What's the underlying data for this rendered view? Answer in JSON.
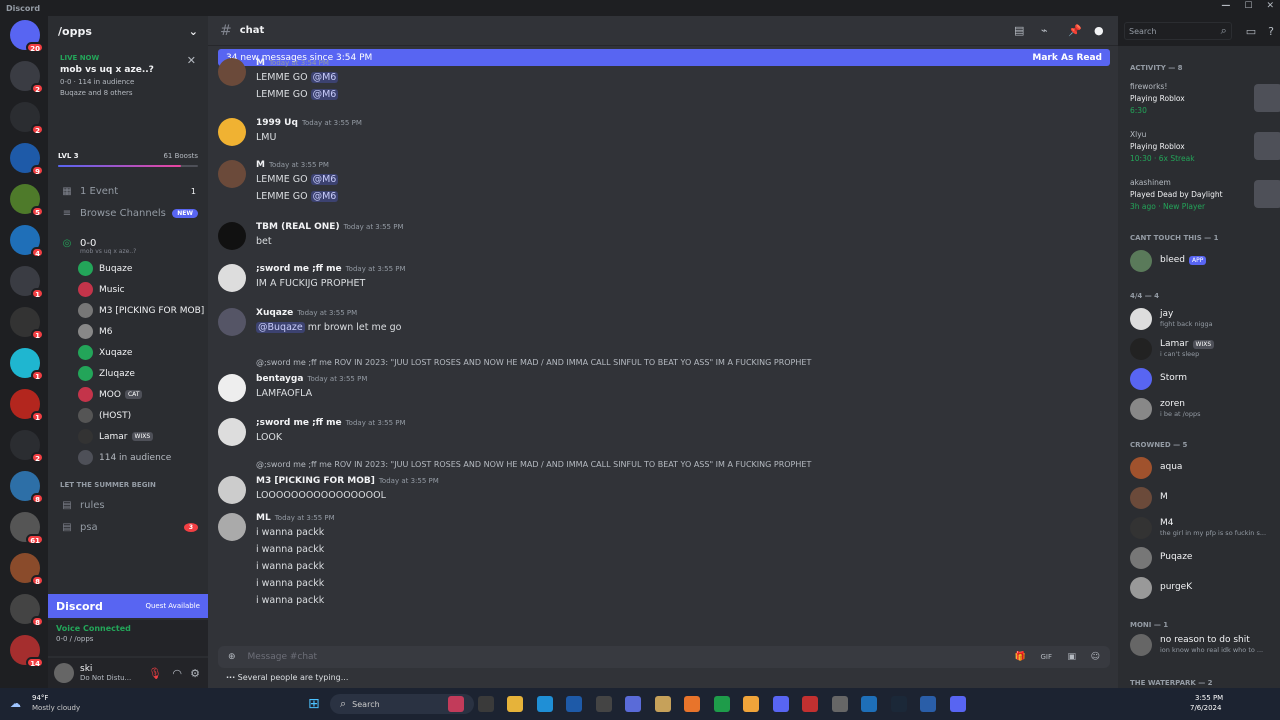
{
  "titlebar": {
    "app": "Discord"
  },
  "guilds": [
    {
      "badge": "20",
      "color": "#5865f2"
    },
    {
      "badge": "2",
      "color": "#3a3c43"
    },
    {
      "badge": "2",
      "color": "#2b2d31"
    },
    {
      "badge": "9",
      "color": "#1e5aa8"
    },
    {
      "badge": "5",
      "color": "#4e7a2a"
    },
    {
      "badge": "4",
      "color": "#1f6fb8"
    },
    {
      "badge": "1",
      "color": "#3a3c43"
    },
    {
      "badge": "1",
      "color": "#333"
    },
    {
      "badge": "1",
      "color": "#1fb6d0"
    },
    {
      "badge": "1",
      "color": "#b3261e"
    },
    {
      "badge": "2",
      "color": "#2b2d31"
    },
    {
      "badge": "8",
      "color": "#2d6fa7"
    },
    {
      "badge": "61",
      "color": "#555"
    },
    {
      "badge": "8",
      "color": "#8a4b2b"
    },
    {
      "badge": "8",
      "color": "#444"
    },
    {
      "badge": "14",
      "color": "#a52e2e"
    }
  ],
  "server": {
    "name": "/opps",
    "chevron": "⌄"
  },
  "live": {
    "tag": "LIVE NOW",
    "title": "mob vs uq x aze..?",
    "stats": "0-0 · 114 in audience",
    "who": "Buqaze and 8 others"
  },
  "level": {
    "label": "LVL 3",
    "boosts": "61 Boosts",
    "progress": 0.88
  },
  "nav": {
    "events": "1 Event",
    "events_count": "1",
    "browse": "Browse Channels",
    "new_badge": "NEW"
  },
  "stage": {
    "name": "0-0",
    "topic": "mob vs uq x aze..?"
  },
  "voice_members": [
    {
      "name": "Buqaze",
      "color": "#23a559"
    },
    {
      "name": "Music",
      "color": "#c4344a"
    },
    {
      "name": "M3 [PICKING FOR MOB]",
      "color": "#777"
    },
    {
      "name": "M6",
      "color": "#888"
    },
    {
      "name": "Xuqaze",
      "color": "#23a559"
    },
    {
      "name": "Zluqaze",
      "color": "#23a559"
    },
    {
      "name": "MOO",
      "color": "#c4344a",
      "badge": "CAT"
    },
    {
      "name": "(HOST)",
      "color": "#555"
    },
    {
      "name": "Lamar",
      "color": "#333",
      "badge": "WIXS"
    }
  ],
  "audience": "114 in audience",
  "category": "LET THE SUMMER BEGIN",
  "text_channels": [
    {
      "name": "rules"
    },
    {
      "name": "psa",
      "badge": "3"
    }
  ],
  "quest": {
    "brand": "Discord",
    "label": "Quest Available"
  },
  "voice_status": {
    "label": "Voice Connected",
    "channel": "0-0 / /opps"
  },
  "me": {
    "name": "ski",
    "status": "Do Not Distu..."
  },
  "channel": {
    "name": "chat"
  },
  "search": {
    "placeholder": "Search"
  },
  "banner": {
    "text": "34 new messages since 3:54 PM",
    "action": "Mark As Read"
  },
  "messages": [
    {
      "author": "M",
      "time": "Today at 3:54 PM",
      "lines": [
        [
          "LEMME GO ",
          "@M6"
        ],
        [
          "LEMME GO ",
          "@M6"
        ]
      ],
      "color": "#6b4a3a"
    },
    {
      "author": "1999 Uq",
      "time": "Today at 3:55 PM",
      "lines": [
        [
          "LMU"
        ]
      ],
      "color": "#f0b232"
    },
    {
      "author": "M",
      "time": "Today at 3:55 PM",
      "lines": [
        [
          "LEMME GO ",
          "@M6"
        ],
        [
          "LEMME GO ",
          "@M6"
        ]
      ],
      "color": "#6b4a3a"
    },
    {
      "author": "TBM (REAL ONE)",
      "time": "Today at 3:55 PM",
      "lines": [
        [
          "bet"
        ]
      ],
      "color": "#111"
    },
    {
      "author": ";sword me ;ff me",
      "time": "Today at 3:55 PM",
      "lines": [
        [
          "IM A FUCKIJG PROPHET"
        ]
      ],
      "color": "#ddd"
    },
    {
      "author": "Xuqaze",
      "time": "Today at 3:55 PM",
      "lines": [
        [
          "@Buqaze",
          " mr brown let me go"
        ]
      ],
      "color": "#556"
    },
    {
      "reply": "@;sword me ;ff me ROV IN 2023: \"JUU LOST ROSES AND NOW HE MAD / AND IMMA CALL SINFUL TO BEAT YO ASS\" IM A FUCKING PROPHET",
      "author": "bentayga",
      "time": "Today at 3:55 PM",
      "lines": [
        [
          "LAMFAOFLA"
        ]
      ],
      "color": "#eee"
    },
    {
      "author": ";sword me ;ff me",
      "time": "Today at 3:55 PM",
      "lines": [
        [
          "LOOK"
        ]
      ],
      "color": "#ddd"
    },
    {
      "reply": "@;sword me ;ff me ROV IN 2023: \"JUU LOST ROSES AND NOW HE MAD / AND IMMA CALL SINFUL TO BEAT YO ASS\" IM A FUCKING PROPHET",
      "author": "M3 [PICKING FOR MOB]",
      "time": "Today at 3:55 PM",
      "lines": [
        [
          "LOOOOOOOOOOOOOOOOL"
        ]
      ],
      "color": "#ccc"
    },
    {
      "author": "ML",
      "time": "Today at 3:55 PM",
      "lines": [
        [
          "i wanna packk"
        ],
        [
          "i wanna packk"
        ],
        [
          "i wanna packk"
        ],
        [
          "i wanna packk"
        ],
        [
          "i wanna packk"
        ]
      ],
      "color": "#aaa"
    }
  ],
  "composer": {
    "placeholder": "Message #chat"
  },
  "typing": "Several people are typing...",
  "activity": {
    "header": "ACTIVITY — 8",
    "items": [
      {
        "name": "fireworks!",
        "activity": "Playing Roblox",
        "meta": "6:30"
      },
      {
        "name": "Xlyu",
        "activity": "Playing Roblox",
        "meta": "10:30 · 6x Streak"
      },
      {
        "name": "akashinem",
        "activity": "Played Dead by Daylight",
        "meta": "3h ago · New Player"
      }
    ]
  },
  "sections": [
    {
      "title": "CANT TOUCH THIS — 1",
      "members": [
        {
          "name": "bleed",
          "sub": "",
          "badge": "APP",
          "color": "#5a7a5a"
        }
      ]
    },
    {
      "title": "4/4 — 4",
      "members": [
        {
          "name": "jay",
          "sub": "fight back nigga",
          "color": "#ddd"
        },
        {
          "name": "Lamar",
          "sub": "i can't sleep",
          "badge": "WIXS",
          "color": "#222"
        },
        {
          "name": "Storm",
          "sub": "",
          "color": "#5865f2"
        },
        {
          "name": "zoren",
          "sub": "i be at /opps",
          "color": "#888"
        }
      ]
    },
    {
      "title": "CROWNED — 5",
      "members": [
        {
          "name": "aqua",
          "sub": "",
          "color": "#a0522d"
        },
        {
          "name": "M",
          "sub": "",
          "color": "#6b4a3a"
        },
        {
          "name": "M4",
          "sub": "the girl in my pfp is so fuckin s...",
          "color": "#333"
        },
        {
          "name": "Puqaze",
          "sub": "",
          "color": "#777"
        },
        {
          "name": "purgeK",
          "sub": "",
          "color": "#999"
        }
      ]
    },
    {
      "title": "MONI — 1",
      "members": [
        {
          "name": "no reason to do shit",
          "sub": "ion know who real idk who to ...",
          "color": "#666"
        }
      ]
    },
    {
      "title": "THE WATERPARK — 2",
      "members": []
    }
  ],
  "taskbar": {
    "weather_temp": "94°F",
    "weather_desc": "Mostly cloudy",
    "search": "Search",
    "time": "3:55 PM",
    "date": "7/6/2024"
  }
}
